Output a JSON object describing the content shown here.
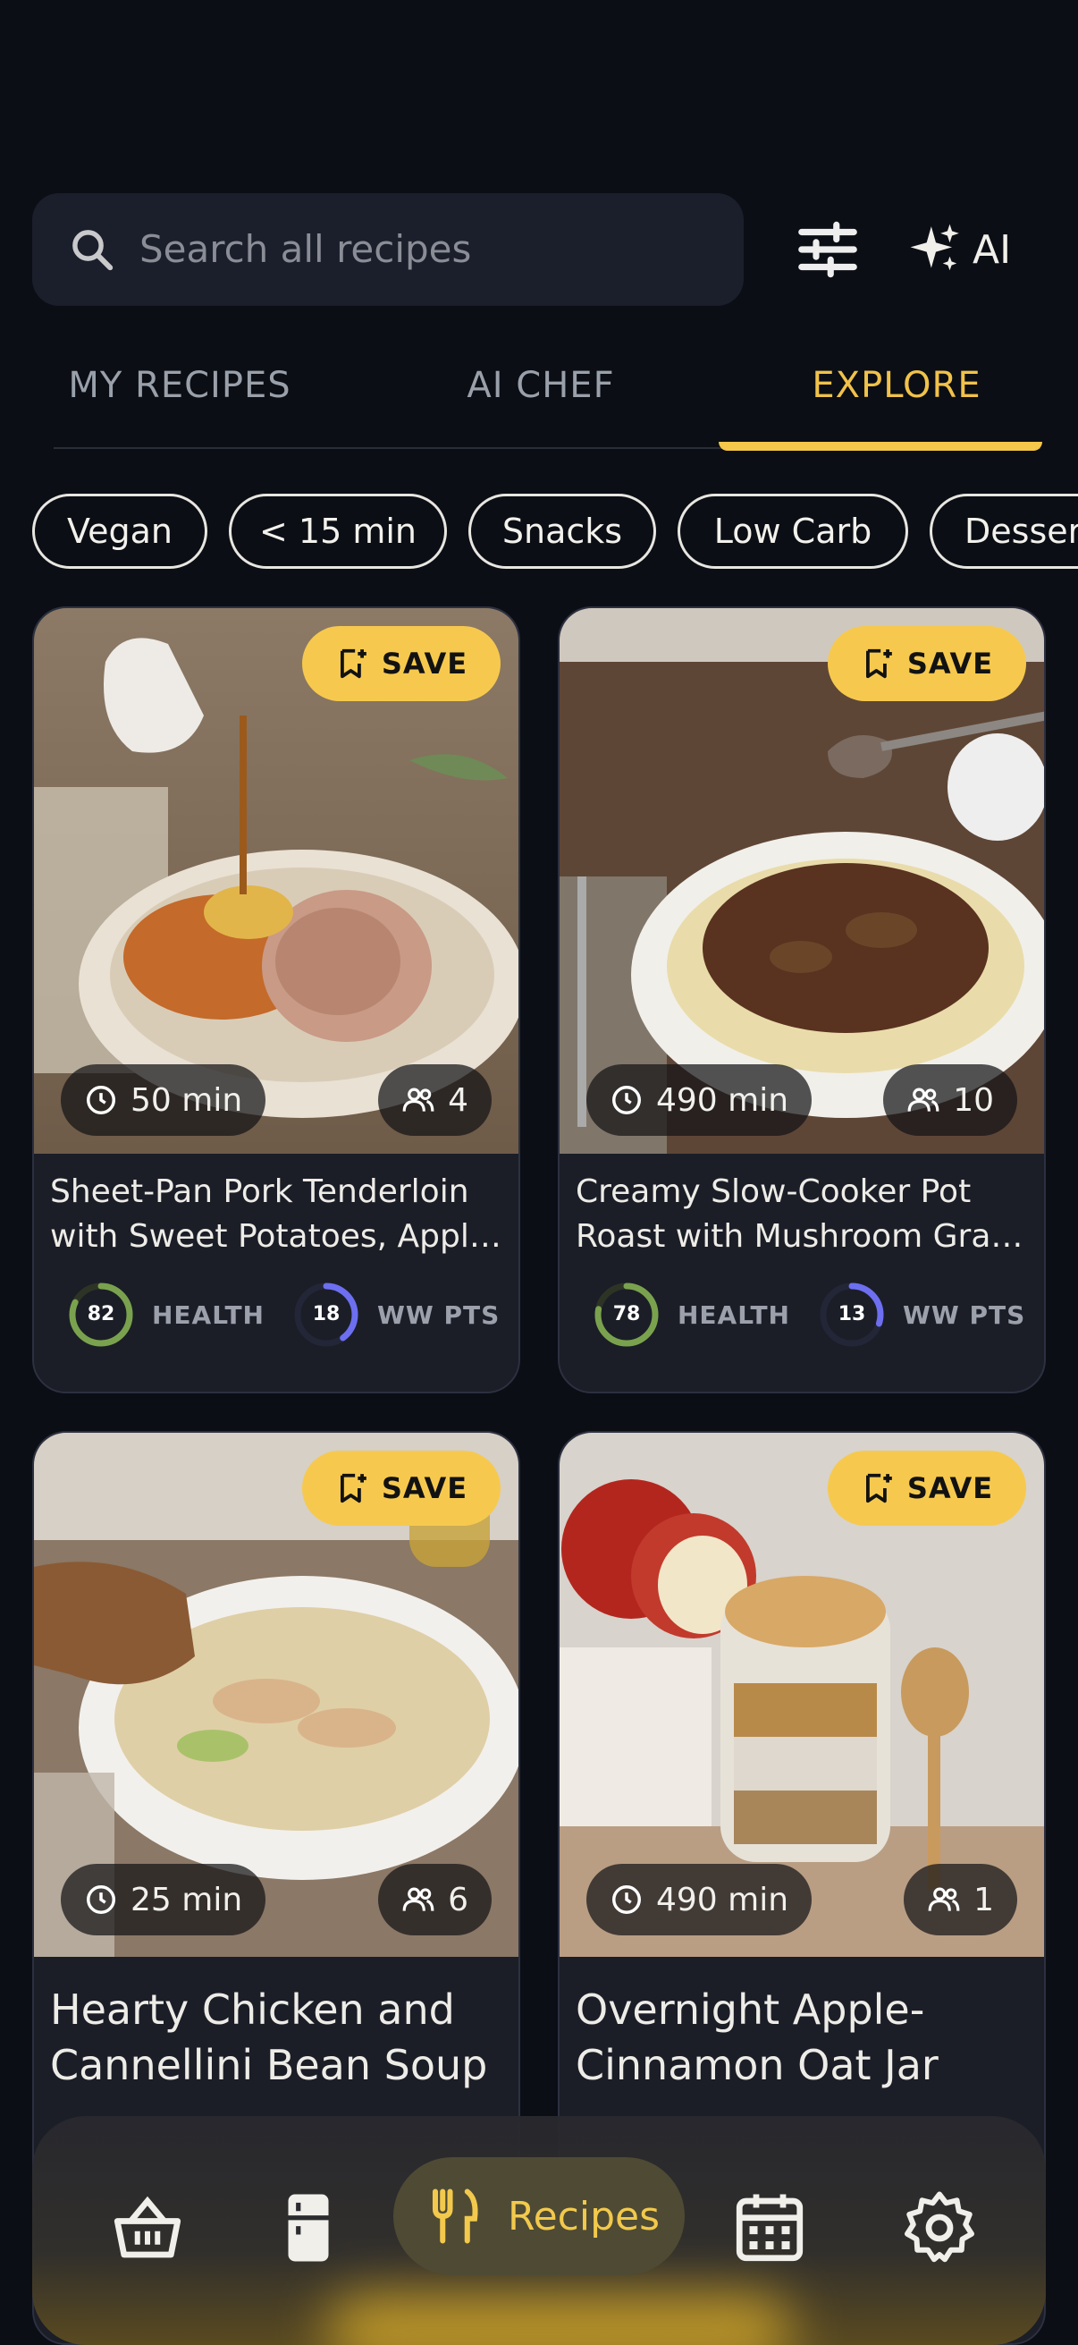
{
  "search": {
    "placeholder": "Search all recipes"
  },
  "header": {
    "ai_label": "AI"
  },
  "tabs": [
    {
      "label": "MY RECIPES",
      "active": false
    },
    {
      "label": "AI CHEF",
      "active": false
    },
    {
      "label": "EXPLORE",
      "active": true
    }
  ],
  "chips": [
    "Vegan",
    "< 15 min",
    "Snacks",
    "Low Carb",
    "Desserts"
  ],
  "save_label": "SAVE",
  "recipes": [
    {
      "title_line1": "Sheet-Pan Pork Tenderloin",
      "title_line2": "with Sweet Potatoes, Apple...",
      "time": "50 min",
      "servings": "4",
      "health_score": "82",
      "health_label": "HEALTH",
      "health_fraction": 0.82,
      "ww_points": "18",
      "ww_label": "WW PTS",
      "ww_fraction": 0.4
    },
    {
      "title_line1": "Creamy Slow-Cooker Pot",
      "title_line2": "Roast with Mushroom Gravy...",
      "time": "490 min",
      "servings": "10",
      "health_score": "78",
      "health_label": "HEALTH",
      "health_fraction": 0.78,
      "ww_points": "13",
      "ww_label": "WW PTS",
      "ww_fraction": 0.3
    },
    {
      "title_line1": "Hearty Chicken and",
      "title_line2": "Cannellini Bean Soup",
      "time": "25 min",
      "servings": "6"
    },
    {
      "title_line1": "Overnight Apple-",
      "title_line2": "Cinnamon Oat Jar",
      "time": "490 min",
      "servings": "1"
    }
  ],
  "nav": {
    "items": [
      "basket-icon",
      "fridge-icon",
      "recipes",
      "calendar-icon",
      "settings-icon"
    ],
    "recipes_label": "Recipes",
    "accent": "#f5c74a"
  }
}
